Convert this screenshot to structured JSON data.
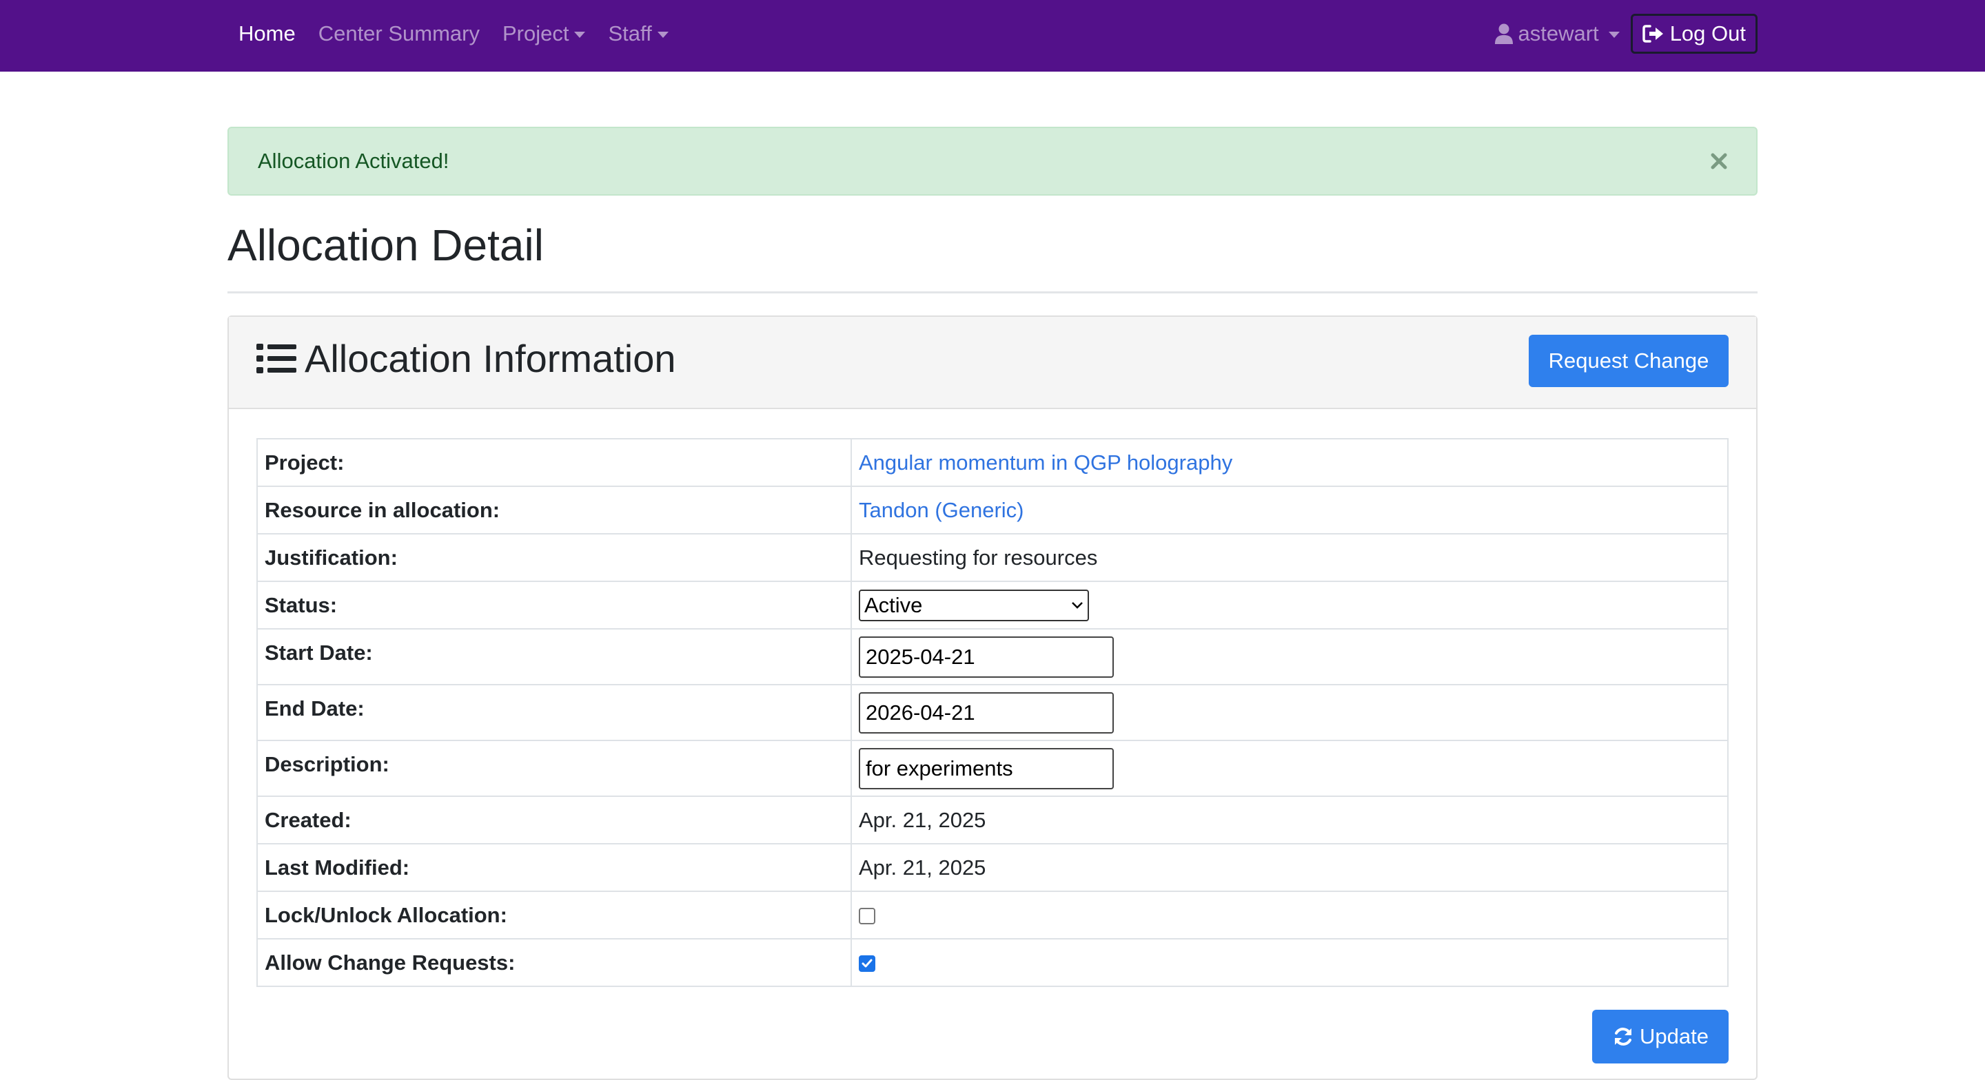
{
  "navbar": {
    "items": [
      {
        "label": "Home",
        "active": true
      },
      {
        "label": "Center Summary",
        "active": false
      },
      {
        "label": "Project",
        "active": false,
        "dropdown": true
      },
      {
        "label": "Staff",
        "active": false,
        "dropdown": true
      }
    ],
    "user_name": "astewart",
    "logout_label": "Log Out"
  },
  "alert": {
    "message": "Allocation Activated!"
  },
  "page": {
    "title": "Allocation Detail"
  },
  "card": {
    "title": "Allocation Information",
    "request_change_label": "Request Change",
    "update_label": "Update"
  },
  "fields": {
    "project": {
      "label": "Project:",
      "value": "Angular momentum in QGP holography"
    },
    "resource": {
      "label": "Resource in allocation:",
      "value": "Tandon (Generic)"
    },
    "justification": {
      "label": "Justification:",
      "value": "Requesting for resources"
    },
    "status": {
      "label": "Status:",
      "value": "Active"
    },
    "start_date": {
      "label": "Start Date:",
      "value": "2025-04-21"
    },
    "end_date": {
      "label": "End Date:",
      "value": "2026-04-21"
    },
    "description": {
      "label": "Description:",
      "value": "for experiments"
    },
    "created": {
      "label": "Created:",
      "value": "Apr. 21, 2025"
    },
    "last_modified": {
      "label": "Last Modified:",
      "value": "Apr. 21, 2025"
    },
    "lock": {
      "label": "Lock/Unlock Allocation:",
      "checked": false
    },
    "allow_change": {
      "label": "Allow Change Requests:",
      "checked": true
    }
  },
  "colors": {
    "navbar_bg": "#53118a",
    "primary": "#2f80ed",
    "link": "#2f73e0",
    "alert_bg": "#d4edda",
    "alert_text": "#155724"
  },
  "icons": {
    "user": "user-icon",
    "logout": "sign-out-icon",
    "close": "close-icon",
    "list": "list-icon",
    "update": "sync-icon"
  }
}
